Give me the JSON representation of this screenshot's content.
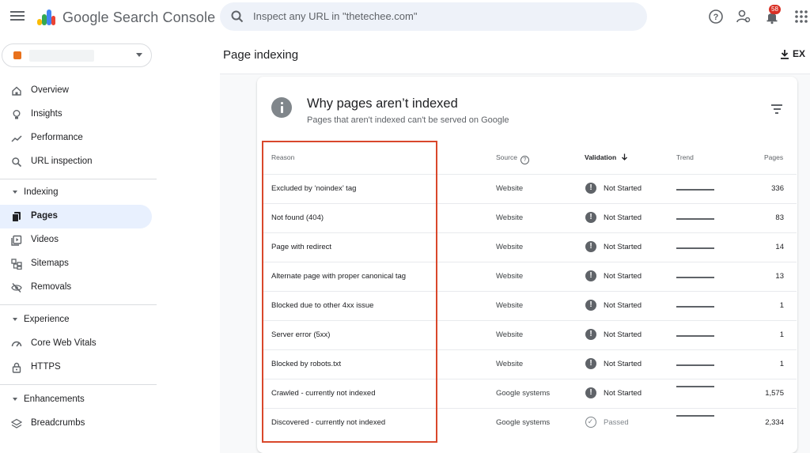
{
  "app": {
    "name": "Google Search Console"
  },
  "search": {
    "placeholder": "Inspect any URL in \"thetechee.com\""
  },
  "header": {
    "notification_count": "58"
  },
  "sidebar": {
    "items": [
      {
        "label": "Overview",
        "icon": "home-icon"
      },
      {
        "label": "Insights",
        "icon": "lightbulb-icon"
      },
      {
        "label": "Performance",
        "icon": "trending-icon"
      },
      {
        "label": "URL inspection",
        "icon": "search-icon"
      }
    ],
    "indexing": {
      "label": "Indexing",
      "items": [
        {
          "label": "Pages",
          "icon": "pages-icon",
          "active": true
        },
        {
          "label": "Videos",
          "icon": "video-icon"
        },
        {
          "label": "Sitemaps",
          "icon": "sitemap-icon"
        },
        {
          "label": "Removals",
          "icon": "removals-icon"
        }
      ]
    },
    "experience": {
      "label": "Experience",
      "items": [
        {
          "label": "Core Web Vitals",
          "icon": "gauge-icon"
        },
        {
          "label": "HTTPS",
          "icon": "lock-icon"
        }
      ]
    },
    "enhancements": {
      "label": "Enhancements",
      "items": [
        {
          "label": "Breadcrumbs",
          "icon": "layers-icon"
        }
      ]
    }
  },
  "main": {
    "page_title": "Page indexing",
    "export_label": "EX",
    "card": {
      "title": "Why pages aren’t indexed",
      "subtitle": "Pages that aren't indexed can't be served on Google"
    },
    "table": {
      "headers": {
        "reason": "Reason",
        "source": "Source",
        "validation": "Validation",
        "trend": "Trend",
        "pages": "Pages"
      },
      "rows": [
        {
          "reason": "Excluded by ‘noindex’ tag",
          "source": "Website",
          "validation": "Not Started",
          "pages": "336"
        },
        {
          "reason": "Not found (404)",
          "source": "Website",
          "validation": "Not Started",
          "pages": "83"
        },
        {
          "reason": "Page with redirect",
          "source": "Website",
          "validation": "Not Started",
          "pages": "14"
        },
        {
          "reason": "Alternate page with proper canonical tag",
          "source": "Website",
          "validation": "Not Started",
          "pages": "13"
        },
        {
          "reason": "Blocked due to other 4xx issue",
          "source": "Website",
          "validation": "Not Started",
          "pages": "1"
        },
        {
          "reason": "Server error (5xx)",
          "source": "Website",
          "validation": "Not Started",
          "pages": "1"
        },
        {
          "reason": "Blocked by robots.txt",
          "source": "Website",
          "validation": "Not Started",
          "pages": "1"
        },
        {
          "reason": "Crawled - currently not indexed",
          "source": "Google systems",
          "validation": "Not Started",
          "pages": "1,575"
        },
        {
          "reason": "Discovered - currently not indexed",
          "source": "Google systems",
          "validation": "Passed",
          "pages": "2,334"
        }
      ]
    }
  },
  "colors": {
    "accent": "#1a73e8",
    "active_nav": "#e8f0fe",
    "highlight_box": "#d9472b",
    "status_gray": "#5f6368"
  }
}
